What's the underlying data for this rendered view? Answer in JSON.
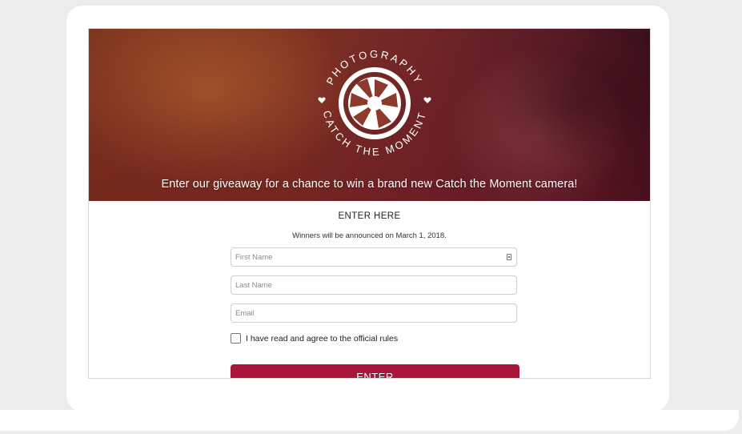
{
  "hero": {
    "logo_top_text": "PHOTOGRAPHY",
    "logo_bottom_text": "CATCH THE MOMENT",
    "logo_icon": "camera-shutter-icon",
    "decor_icon": "heart-icon",
    "caption": "Enter our giveaway for a chance to win a brand new Catch the Moment camera!"
  },
  "form": {
    "title": "ENTER HERE",
    "subtitle": "Winners will be announced on March 1, 2018.",
    "first_name_placeholder": "First Name",
    "last_name_placeholder": "Last Name",
    "email_placeholder": "Email",
    "rules_label": "I have read and agree to the official rules",
    "submit_label": "ENTER"
  },
  "colors": {
    "accent": "#a8163a",
    "hero_tint": "#5a1c27"
  }
}
